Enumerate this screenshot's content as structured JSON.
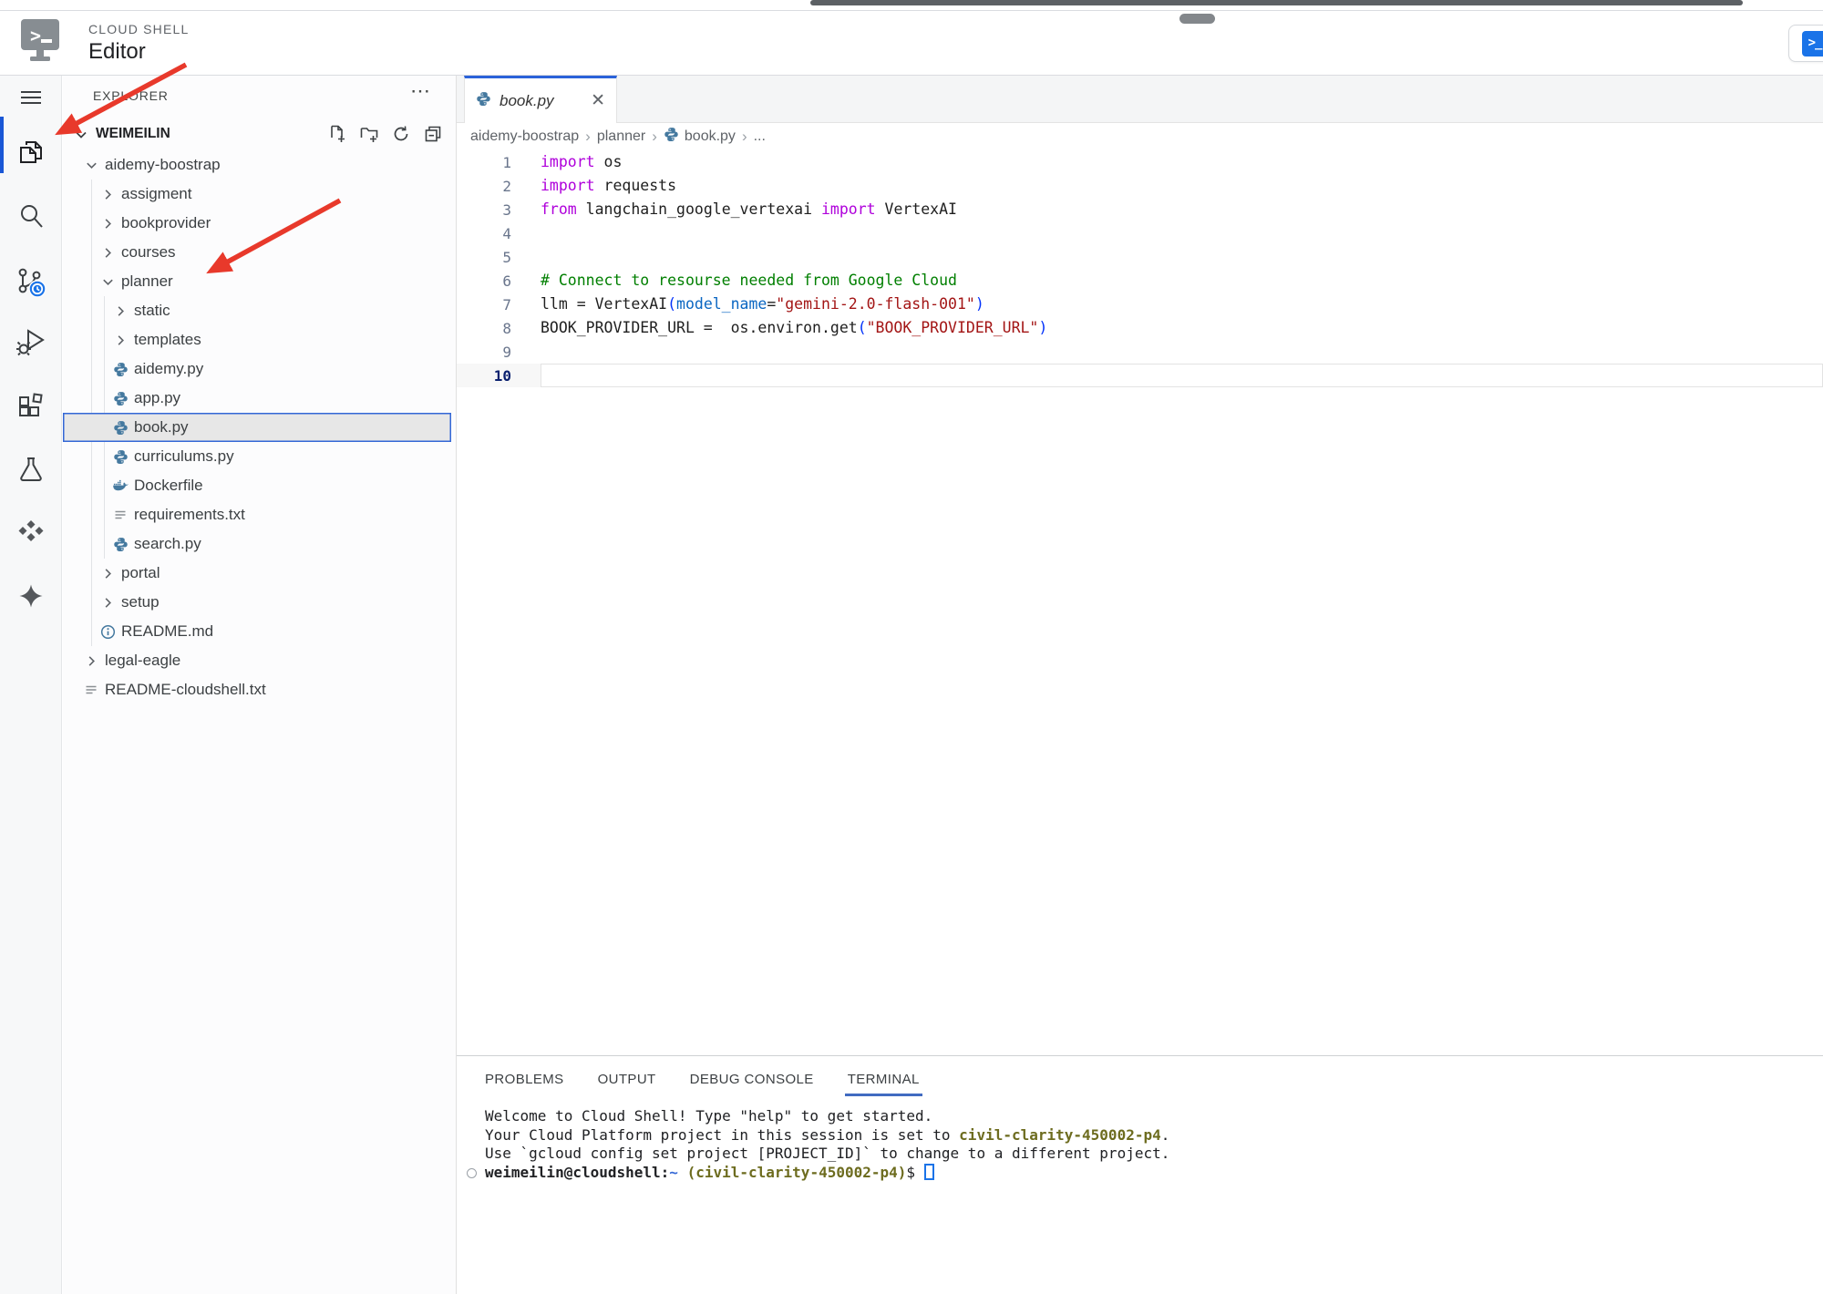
{
  "header": {
    "product": "CLOUD SHELL",
    "title": "Editor"
  },
  "open_terminal_button": {
    "icon": "terminal-prompt-icon",
    "glyph": ">_"
  },
  "activity_bar": {
    "items": [
      {
        "id": "menu",
        "icon": "hamburger-icon"
      },
      {
        "id": "explorer",
        "icon": "files-icon",
        "active": true
      },
      {
        "id": "search",
        "icon": "search-icon"
      },
      {
        "id": "source-control",
        "icon": "source-control-clock-icon"
      },
      {
        "id": "run-debug",
        "icon": "debug-play-bug-icon"
      },
      {
        "id": "extensions",
        "icon": "extensions-icon"
      },
      {
        "id": "testing",
        "icon": "beaker-icon"
      },
      {
        "id": "marketplace",
        "icon": "diamonds-icon"
      },
      {
        "id": "gemini",
        "icon": "sparkle-icon"
      }
    ]
  },
  "explorer": {
    "title": "EXPLORER",
    "more_actions_icon": "ellipsis-icon",
    "workspace": "WEIMEILIN",
    "toolbar_icons": [
      "new-file-icon",
      "new-folder-icon",
      "refresh-icon",
      "collapse-all-icon"
    ],
    "tree": [
      {
        "label": "aidemy-boostrap",
        "type": "folder",
        "expanded": true,
        "level": 1
      },
      {
        "label": "assigment",
        "type": "folder",
        "expanded": false,
        "level": 2
      },
      {
        "label": "bookprovider",
        "type": "folder",
        "expanded": false,
        "level": 2
      },
      {
        "label": "courses",
        "type": "folder",
        "expanded": false,
        "level": 2
      },
      {
        "label": "planner",
        "type": "folder",
        "expanded": true,
        "level": 2
      },
      {
        "label": "static",
        "type": "folder",
        "expanded": false,
        "level": 3
      },
      {
        "label": "templates",
        "type": "folder",
        "expanded": false,
        "level": 3
      },
      {
        "label": "aidemy.py",
        "type": "python",
        "level": 3
      },
      {
        "label": "app.py",
        "type": "python",
        "level": 3
      },
      {
        "label": "book.py",
        "type": "python",
        "level": 3,
        "selected": true
      },
      {
        "label": "curriculums.py",
        "type": "python",
        "level": 3
      },
      {
        "label": "Dockerfile",
        "type": "docker",
        "level": 3
      },
      {
        "label": "requirements.txt",
        "type": "text",
        "level": 3
      },
      {
        "label": "search.py",
        "type": "python",
        "level": 3
      },
      {
        "label": "portal",
        "type": "folder",
        "expanded": false,
        "level": 2
      },
      {
        "label": "setup",
        "type": "folder",
        "expanded": false,
        "level": 2
      },
      {
        "label": "README.md",
        "type": "info",
        "level": 2
      },
      {
        "label": "legal-eagle",
        "type": "folder",
        "expanded": false,
        "level": 1
      },
      {
        "label": "README-cloudshell.txt",
        "type": "text",
        "level": 1
      }
    ]
  },
  "editor": {
    "tab": {
      "label": "book.py",
      "icon": "python-icon",
      "close_icon": "close-icon",
      "preview_italic": true
    },
    "breadcrumb": [
      {
        "label": "aidemy-boostrap"
      },
      {
        "label": "planner"
      },
      {
        "label": "book.py",
        "icon": "python-icon"
      },
      {
        "label": "..."
      }
    ],
    "code": {
      "active_line": 10,
      "lines": [
        {
          "n": 1,
          "segs": [
            {
              "t": "import",
              "s": "k"
            },
            {
              "t": " os",
              "s": "p"
            }
          ]
        },
        {
          "n": 2,
          "segs": [
            {
              "t": "import",
              "s": "k"
            },
            {
              "t": " requests",
              "s": "p"
            }
          ]
        },
        {
          "n": 3,
          "segs": [
            {
              "t": "from",
              "s": "k"
            },
            {
              "t": " langchain_google_vertexai ",
              "s": "p"
            },
            {
              "t": "import",
              "s": "k"
            },
            {
              "t": " VertexAI",
              "s": "p"
            }
          ]
        },
        {
          "n": 4,
          "segs": []
        },
        {
          "n": 5,
          "segs": []
        },
        {
          "n": 6,
          "segs": [
            {
              "t": "# Connect to resourse needed from Google Cloud",
              "s": "c"
            }
          ]
        },
        {
          "n": 7,
          "segs": [
            {
              "t": "llm = VertexAI",
              "s": "p"
            },
            {
              "t": "(",
              "s": "br"
            },
            {
              "t": "model_name",
              "s": "pm"
            },
            {
              "t": "=",
              "s": "p"
            },
            {
              "t": "\"gemini-2.0-flash-001\"",
              "s": "s"
            },
            {
              "t": ")",
              "s": "br"
            }
          ]
        },
        {
          "n": 8,
          "segs": [
            {
              "t": "BOOK_PROVIDER_URL =  os.environ.get",
              "s": "p"
            },
            {
              "t": "(",
              "s": "br"
            },
            {
              "t": "\"BOOK_PROVIDER_URL\"",
              "s": "s"
            },
            {
              "t": ")",
              "s": "br"
            }
          ]
        },
        {
          "n": 9,
          "segs": []
        },
        {
          "n": 10,
          "segs": []
        }
      ]
    }
  },
  "panel": {
    "tabs": [
      "PROBLEMS",
      "OUTPUT",
      "DEBUG CONSOLE",
      "TERMINAL"
    ],
    "active_tab": "TERMINAL",
    "terminal": {
      "lines": [
        {
          "segs": [
            {
              "t": "Welcome to Cloud Shell! Type \"help\" to get started.",
              "s": "p"
            }
          ]
        },
        {
          "segs": [
            {
              "t": "Your Cloud Platform project in this session is set to ",
              "s": "p"
            },
            {
              "t": "civil-clarity-450002-p4",
              "s": "ob"
            },
            {
              "t": ".",
              "s": "p"
            }
          ]
        },
        {
          "segs": [
            {
              "t": "Use `gcloud config set project [PROJECT_ID]` to change to a different project.",
              "s": "p"
            }
          ]
        },
        {
          "decoration": true,
          "cursor": true,
          "segs": [
            {
              "t": "weimeilin@cloudshell:",
              "s": "b"
            },
            {
              "t": "~",
              "s": "bb"
            },
            {
              "t": " ",
              "s": "p"
            },
            {
              "t": "(civil-clarity-450002-p4)",
              "s": "ob"
            },
            {
              "t": "$ ",
              "s": "p"
            }
          ]
        }
      ]
    }
  },
  "annotations": {
    "arrow_count": 2,
    "arrow_targets": [
      "explorer-activity-icon",
      "planner-folder"
    ]
  },
  "colors": {
    "accent_blue": "#1a73e8",
    "tab_accent": "#2a62d9",
    "arrow_red": "#e8392b",
    "selection_border": "#3367d6",
    "icon_steel_blue": "#45799f",
    "keyword": "#af00db",
    "comment": "#007f00",
    "string": "#a31515",
    "bracket": "#0433fa",
    "parameter": "#0a66c2",
    "terminal_olive": "#6d6c1f",
    "terminal_blue": "#3569d6",
    "active_line_number": "#0b216f"
  }
}
